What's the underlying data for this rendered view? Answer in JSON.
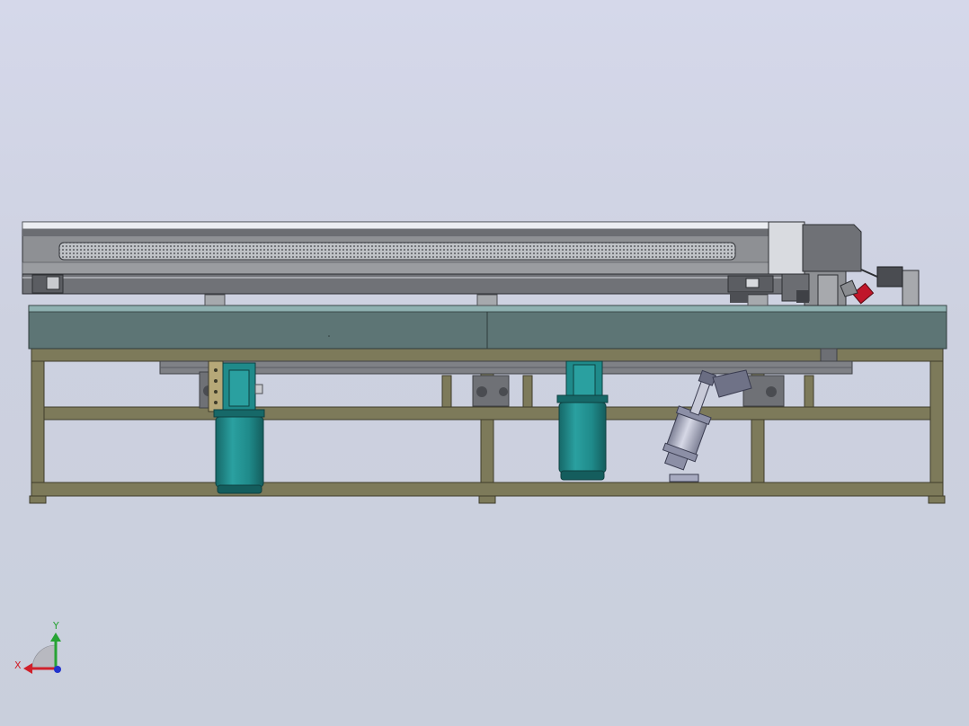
{
  "viewport": {
    "background_top": "#d5d8ea",
    "background_bottom": "#c9cfdc"
  },
  "model": {
    "frame_color": "#7d7a5a",
    "table_top_color": "#5d7575",
    "table_top_highlight": "#8fb1b1",
    "beam_color": "#8e9094",
    "beam_dark": "#4d4f54",
    "motor_color": "#1f8a8a",
    "motor_dark": "#166868",
    "cylinder_color": "#a7aac0",
    "valve_color": "#c0162a"
  },
  "triad": {
    "x_label": "X",
    "y_label": "Y",
    "x_color": "#d0202a",
    "y_color": "#27a334",
    "z_color": "#2233cc"
  }
}
